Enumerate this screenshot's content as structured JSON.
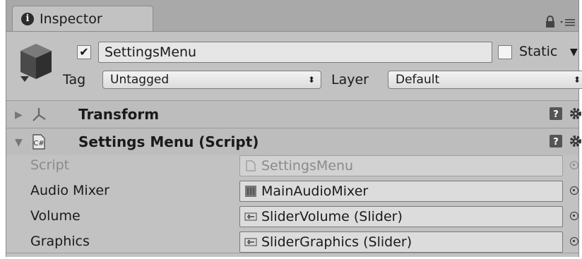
{
  "tab": {
    "title": "Inspector",
    "icon": "info-icon"
  },
  "header": {
    "object_icon": "gameobject-cube-icon",
    "active": true,
    "name": "SettingsMenu",
    "static_label": "Static",
    "static": false,
    "tag_label": "Tag",
    "tag_value": "Untagged",
    "layer_label": "Layer",
    "layer_value": "Default"
  },
  "components": [
    {
      "title": "Transform",
      "icon": "transform-icon",
      "expanded": false
    },
    {
      "title": "Settings Menu (Script)",
      "icon": "csharp-script-icon",
      "expanded": true
    }
  ],
  "fields": [
    {
      "label": "Script",
      "value": "SettingsMenu",
      "icon": "script-asset-icon",
      "disabled": true
    },
    {
      "label": "Audio Mixer",
      "value": "MainAudioMixer",
      "icon": "audio-mixer-icon",
      "disabled": false
    },
    {
      "label": "Volume",
      "value": "SliderVolume (Slider)",
      "icon": "slider-icon",
      "disabled": false
    },
    {
      "label": "Graphics",
      "value": "SliderGraphics (Slider)",
      "icon": "slider-icon",
      "disabled": false
    }
  ],
  "colors": {
    "panel_bg": "#c2c2c2",
    "tabbar_bg": "#a9a9a9",
    "field_bg": "#dcdcdc"
  }
}
